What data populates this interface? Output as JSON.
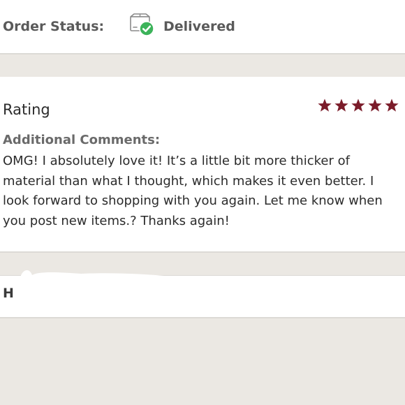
{
  "order_status": {
    "label": "Order Status:",
    "value": "Delivered",
    "icon": "delivered-package-icon",
    "check_color": "#3cb35a"
  },
  "rating": {
    "title": "Rating",
    "stars": 5,
    "max_stars": 5,
    "star_color": "#7b1c2a",
    "comments_label": "Additional Comments:",
    "comment": "OMG! I absolutely love it! It’s a little bit more thicker of material than what I thought, which makes it even better. I look forward to shopping with you again. Let me know when you post new items.? Thanks again!"
  },
  "next_section": {
    "initial": "H"
  }
}
